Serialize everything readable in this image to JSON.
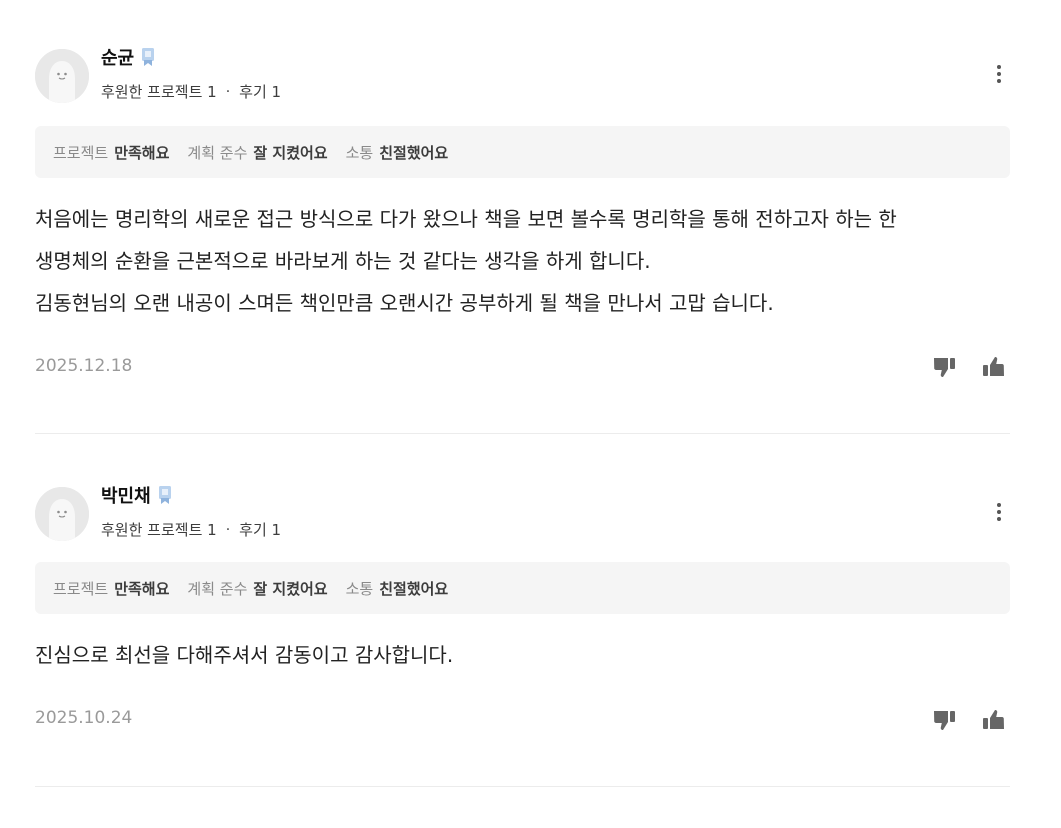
{
  "reviews": [
    {
      "user_name": "순균",
      "meta_projects": "후원한 프로젝트 1",
      "meta_reviews": "후기 1",
      "separator": "·",
      "ratings": [
        {
          "label": "프로젝트",
          "value": "만족해요"
        },
        {
          "label": "계획 준수",
          "value": "잘 지켰어요"
        },
        {
          "label": "소통",
          "value": "친절했어요"
        }
      ],
      "body_lines": [
        "처음에는 명리학의 새로운 접근 방식으로 다가 왔으나 책을 보면 볼수록 명리학을 통해 전하고자 하는 한",
        "생명체의 순환을 근본적으로 바라보게 하는 것 같다는 생각을 하게 합니다.",
        "김동현님의 오랜 내공이 스며든 책인만큼 오랜시간 공부하게 될 책을 만나서 고맙 습니다."
      ],
      "date": "2025.12.18"
    },
    {
      "user_name": "박민채",
      "meta_projects": "후원한 프로젝트 1",
      "meta_reviews": "후기 1",
      "separator": "·",
      "ratings": [
        {
          "label": "프로젝트",
          "value": "만족해요"
        },
        {
          "label": "계획 준수",
          "value": "잘 지켰어요"
        },
        {
          "label": "소통",
          "value": "친절했어요"
        }
      ],
      "body_lines": [
        "진심으로 최선을 다해주셔서 감동이고 감사합니다."
      ],
      "date": "2025.10.24"
    }
  ],
  "icons": {
    "more": "more-vertical-icon",
    "dislike": "thumbs-down-icon",
    "like": "thumbs-up-icon",
    "badge": "supporter-badge-icon",
    "avatar": "default-avatar"
  },
  "colors": {
    "rating_bar_bg": "#f5f5f5",
    "badge_blue": "#a9c8ea",
    "date_gray": "#9a9a9a",
    "icon_gray": "#6b6b6b"
  }
}
